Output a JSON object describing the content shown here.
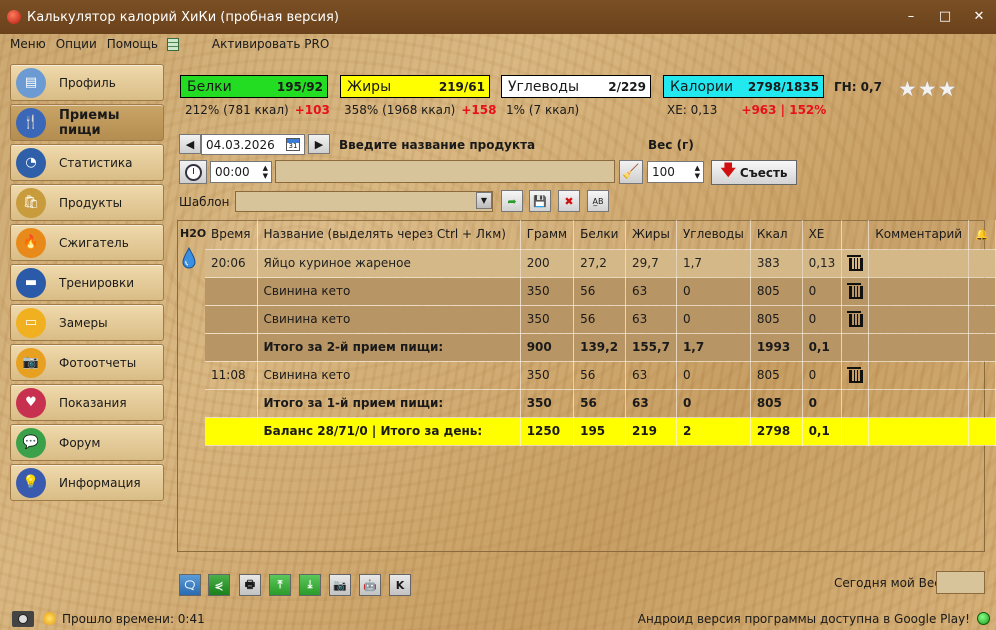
{
  "window": {
    "title": "Калькулятор калорий ХиКи (пробная версия)",
    "minimize": "–",
    "maximize": "□",
    "close": "✕"
  },
  "menu": {
    "items": [
      "Меню",
      "Опции",
      "Помощь"
    ],
    "activate_pro": "Активировать PRO"
  },
  "sidebar": {
    "items": [
      {
        "label": "Профиль",
        "icon": "profile-card-icon",
        "color": "#6b9bd2"
      },
      {
        "label": "Приемы пищи",
        "icon": "fork-knife-icon",
        "color": "#3a67b8",
        "active": true
      },
      {
        "label": "Статистика",
        "icon": "pie-chart-icon",
        "color": "#2f5fa8"
      },
      {
        "label": "Продукты",
        "icon": "grocery-bag-icon",
        "color": "#c89b3c"
      },
      {
        "label": "Сжигатель",
        "icon": "flame-icon",
        "color": "#e88a1a"
      },
      {
        "label": "Тренировки",
        "icon": "dumbbell-icon",
        "color": "#2a5aa8"
      },
      {
        "label": "Замеры",
        "icon": "tape-measure-icon",
        "color": "#f0b020"
      },
      {
        "label": "Фотоотчеты",
        "icon": "camera-icon",
        "color": "#e8a020"
      },
      {
        "label": "Показания",
        "icon": "heartbeat-icon",
        "color": "#c83050"
      },
      {
        "label": "Форум",
        "icon": "chat-bubbles-icon",
        "color": "#3aa04a"
      },
      {
        "label": "Информация",
        "icon": "lightbulb-icon",
        "color": "#3a5ab0"
      }
    ]
  },
  "nutrients": {
    "protein": {
      "name": "Белки",
      "value": "195/92",
      "pct": "212% (781 ккал)",
      "delta": "+103",
      "color": "#22dd22"
    },
    "fat": {
      "name": "Жиры",
      "value": "219/61",
      "pct": "358% (1968 ккал)",
      "delta": "+158",
      "color": "#ffff00"
    },
    "carbs": {
      "name": "Углеводы",
      "value": "2/229",
      "pct": "1% (7 ккал)",
      "color": "#ffffff"
    },
    "calories": {
      "name": "Калории",
      "value": "2798/1835",
      "xe": "ХЕ: 0,13",
      "delta": "+963 | 152%",
      "color": "#22e8f0"
    },
    "gn": "ГН: 0,7",
    "stars": "★★★"
  },
  "entry": {
    "date": "04.03.2026",
    "calendar_day": "31",
    "product_label": "Введите название продукта",
    "weight_label": "Вес (г)",
    "time": "00:00",
    "product_value": "",
    "weight": "100",
    "eat_label": "Съесть",
    "template_label": "Шаблон",
    "template_value": ""
  },
  "table": {
    "h2o": "H2O",
    "columns": [
      "Время",
      "Название (выделять через Ctrl + Лкм)",
      "Грамм",
      "Белки",
      "Жиры",
      "Углеводы",
      "Ккал",
      "ХЕ",
      "",
      "Комментарий"
    ],
    "rows": [
      {
        "type": "sel",
        "cells": [
          "20:06",
          "Яйцо куриное жареное",
          "200",
          "27,2",
          "29,7",
          "1,7",
          "383",
          "0,13"
        ],
        "bin": true
      },
      {
        "type": "dark",
        "cells": [
          "",
          "Свинина кето",
          "350",
          "56",
          "63",
          "0",
          "805",
          "0"
        ],
        "bin": true
      },
      {
        "type": "dark",
        "cells": [
          "",
          "Свинина кето",
          "350",
          "56",
          "63",
          "0",
          "805",
          "0"
        ],
        "bin": true
      },
      {
        "type": "total",
        "cells": [
          "",
          "Итого за 2-й прием пищи:",
          "900",
          "139,2",
          "155,7",
          "1,7",
          "1993",
          "0,1"
        ],
        "bin": false
      },
      {
        "type": "plain",
        "cells": [
          "11:08",
          "Свинина кето",
          "350",
          "56",
          "63",
          "0",
          "805",
          "0"
        ],
        "bin": true
      },
      {
        "type": "total2",
        "cells": [
          "",
          "Итого за 1-й прием пищи:",
          "350",
          "56",
          "63",
          "0",
          "805",
          "0"
        ],
        "bin": false
      },
      {
        "type": "balance",
        "cells": [
          "",
          "Баланс 28/71/0  |  Итого за день:",
          "1250",
          "195",
          "219",
          "2",
          "2798",
          "0,1"
        ],
        "bin": false
      }
    ]
  },
  "bottom": {
    "weight_label": "Сегодня мой Вес",
    "weight_value": "",
    "k_label": "K"
  },
  "status": {
    "elapsed": "Прошло времени: 0:41",
    "android_msg": "Андроид версия программы доступна в Google Play!"
  }
}
